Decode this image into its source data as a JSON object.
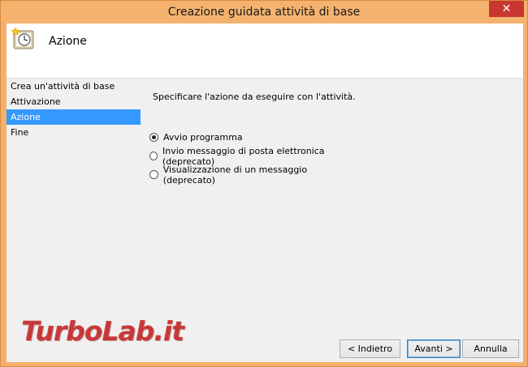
{
  "window": {
    "title": "Creazione guidata attività di base",
    "close_glyph": "✕"
  },
  "header": {
    "icon": "task-clock-icon",
    "title": "Azione"
  },
  "sidebar": {
    "steps": [
      {
        "label": "Crea un'attività di base",
        "active": false
      },
      {
        "label": "Attivazione",
        "active": false
      },
      {
        "label": "Azione",
        "active": true
      },
      {
        "label": "Fine",
        "active": false
      }
    ]
  },
  "main": {
    "instruction": "Specificare l'azione da eseguire con l'attività.",
    "options": [
      {
        "label": "Avvio programma",
        "checked": true
      },
      {
        "label": "Invio messaggio di posta elettronica (deprecato)",
        "checked": false
      },
      {
        "label": "Visualizzazione di un messaggio (deprecato)",
        "checked": false
      }
    ]
  },
  "buttons": {
    "back": "< Indietro",
    "next": "Avanti >",
    "cancel": "Annulla"
  },
  "watermark": "TurboLab.it",
  "colors": {
    "titlebar": "#f4b26e",
    "selection": "#3399ff",
    "close": "#c7372f"
  }
}
